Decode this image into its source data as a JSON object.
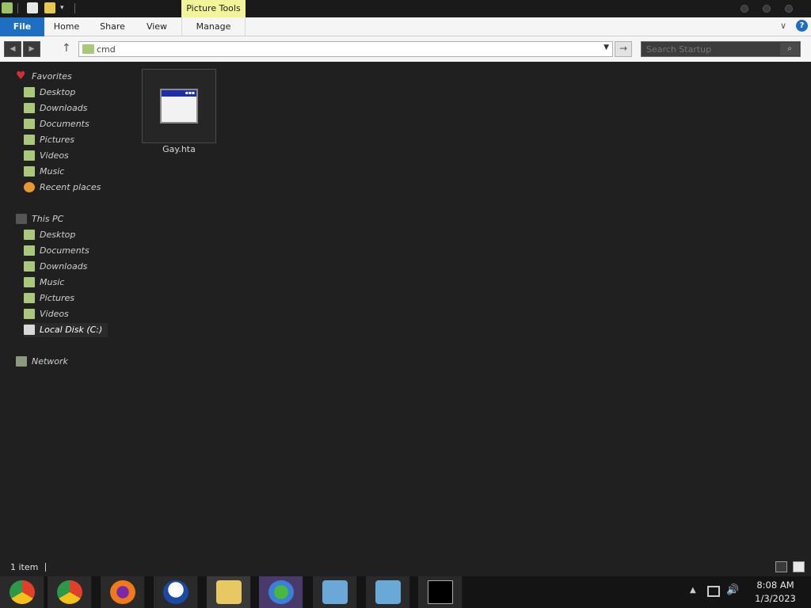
{
  "titlebar": {
    "context_tab": "Picture Tools"
  },
  "ribbon": {
    "tabs": [
      "File",
      "Home",
      "Share",
      "View",
      "Manage"
    ],
    "help": "?",
    "collapse": "∨"
  },
  "address": {
    "value": "cmd",
    "dropdown": "▼",
    "go": "→",
    "up": "↑",
    "back": "◀",
    "forward": "▶"
  },
  "search": {
    "placeholder": "Search Startup",
    "icon": "⌕"
  },
  "nav": {
    "favorites": {
      "label": "Favorites",
      "items": [
        "Desktop",
        "Downloads",
        "Documents",
        "Pictures",
        "Videos",
        "Music",
        "Recent places"
      ]
    },
    "this_pc": {
      "label": "This PC",
      "items": [
        "Desktop",
        "Documents",
        "Downloads",
        "Music",
        "Pictures",
        "Videos",
        "Local Disk (C:)"
      ]
    },
    "network": {
      "label": "Network"
    }
  },
  "content": {
    "file": {
      "name": "Gay.hta",
      "icon": "hta-file-icon"
    }
  },
  "status": {
    "item_count": "1 item"
  },
  "taskbar": {
    "apps": [
      "chrome-beta-icon",
      "chrome-icon",
      "firefox-icon",
      "obama-logo-icon",
      "file-explorer-icon",
      "messenger-icon",
      "installer-icon",
      "installer-icon",
      "command-prompt-icon"
    ],
    "clock_time": "8:08 AM",
    "clock_date": "1/3/2023"
  },
  "colors": {
    "file_tab": "#1e6fc2",
    "picture_tools": "#f3f39a",
    "background": "#202020"
  }
}
